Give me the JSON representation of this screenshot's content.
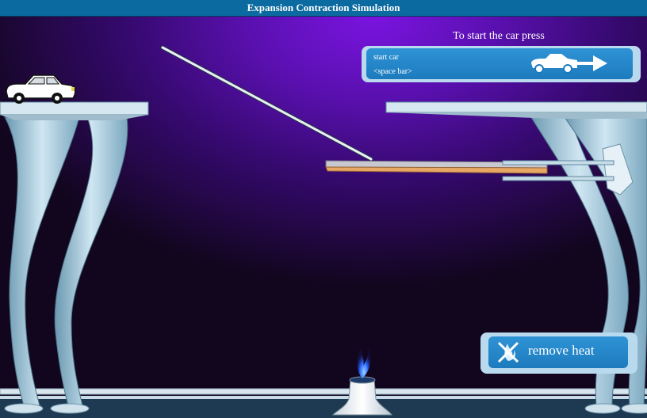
{
  "window": {
    "title": "Expansion  Contraction Simulation"
  },
  "instructions": {
    "text": "To start the car press"
  },
  "start_button": {
    "line1": "start car",
    "line2": "<space bar>",
    "icon": "car-arrow-icon"
  },
  "heat_button": {
    "label": "remove heat",
    "icon": "no-flame-icon"
  },
  "colors": {
    "titlebar": "#0b6aa0",
    "button": "#2e93d6",
    "button_border": "#b9d9ee",
    "strip_top": "#c8c8d0",
    "strip_bottom": "#e8a865",
    "flame": "#2b6cff"
  }
}
